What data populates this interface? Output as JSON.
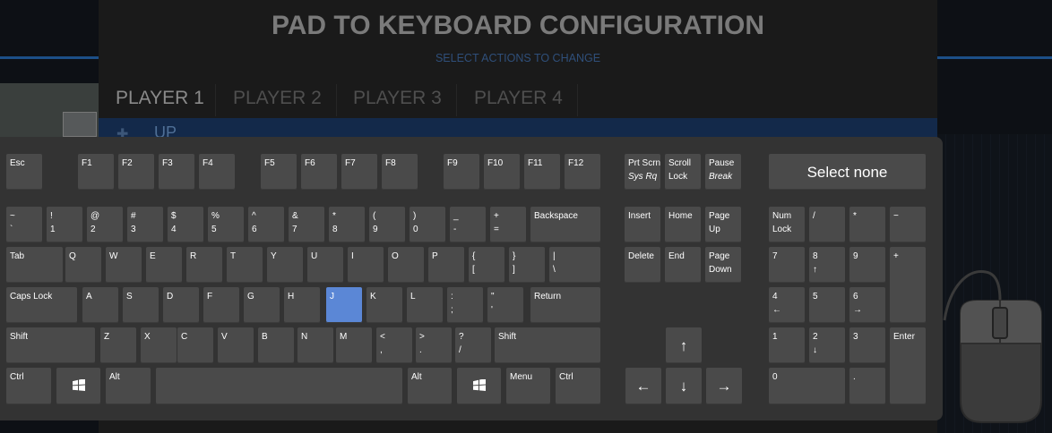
{
  "window": {
    "title": "PAD TO KEYBOARD CONFIGURATION",
    "subtitle": "SELECT ACTIONS TO CHANGE"
  },
  "tabs": [
    {
      "label": "PLAYER 1",
      "active": true
    },
    {
      "label": "PLAYER 2",
      "active": false
    },
    {
      "label": "PLAYER 3",
      "active": false
    },
    {
      "label": "PLAYER 4",
      "active": false
    }
  ],
  "action_row": {
    "label": "UP",
    "icon": "dpad-icon"
  },
  "keyboard": {
    "select_none": "Select none",
    "selected_key": "J",
    "keys": {
      "esc": "Esc",
      "f1": "F1",
      "f2": "F2",
      "f3": "F3",
      "f4": "F4",
      "f5": "F5",
      "f6": "F6",
      "f7": "F7",
      "f8": "F8",
      "f9": "F9",
      "f10": "F10",
      "f11": "F11",
      "f12": "F12",
      "prtscn": "Prt Scrn",
      "sysrq": "Sys Rq",
      "scrolllock1": "Scroll",
      "scrolllock2": "Lock",
      "pause": "Pause",
      "break": "Break",
      "tilde1": "~",
      "tilde2": "`",
      "n1a": "!",
      "n1b": "1",
      "n2a": "@",
      "n2b": "2",
      "n3a": "#",
      "n3b": "3",
      "n4a": "$",
      "n4b": "4",
      "n5a": "%",
      "n5b": "5",
      "n6a": "^",
      "n6b": "6",
      "n7a": "&",
      "n7b": "7",
      "n8a": "*",
      "n8b": "8",
      "n9a": "(",
      "n9b": "9",
      "n0a": ")",
      "n0b": "0",
      "minusa": "_",
      "minusb": "-",
      "eqa": "+",
      "eqb": "=",
      "backspace": "Backspace",
      "insert": "Insert",
      "home": "Home",
      "pageup1": "Page",
      "pageup2": "Up",
      "numlock1": "Num",
      "numlock2": "Lock",
      "npdiv": "/",
      "npmul": "*",
      "npminus": "−",
      "tab": "Tab",
      "q": "Q",
      "w": "W",
      "e": "E",
      "r": "R",
      "t": "T",
      "y": "Y",
      "u": "U",
      "i": "I",
      "o": "O",
      "p": "P",
      "lbra": "{",
      "lbrb": "[",
      "rbra": "}",
      "rbrb": "]",
      "bsla": "|",
      "bslb": "\\",
      "delete": "Delete",
      "end": "End",
      "pagedown1": "Page",
      "pagedown2": "Down",
      "np7": "7",
      "np8a": "8",
      "np8b": "↑",
      "np9": "9",
      "npplus": "+",
      "capslock": "Caps Lock",
      "a": "A",
      "s": "S",
      "d": "D",
      "f": "F",
      "g": "G",
      "h": "H",
      "j": "J",
      "k": "K",
      "l": "L",
      "semia": ":",
      "semib": ";",
      "quota": "\"",
      "quotb": "'",
      "return": "Return",
      "np4a": "4",
      "np4b": "←",
      "np5": "5",
      "np6a": "6",
      "np6b": "→",
      "shift": "Shift",
      "z": "Z",
      "x": "X",
      "c": "C",
      "v": "V",
      "b": "B",
      "n": "N",
      "m": "M",
      "comma1": "<",
      "comma2": ",",
      "dot1": ">",
      "dot2": ".",
      "slash1": "?",
      "slash2": "/",
      "shiftr": "Shift",
      "up": "↑",
      "np1": "1",
      "np2a": "2",
      "np2b": "↓",
      "np3": "3",
      "npenter": "Enter",
      "ctrl": "Ctrl",
      "alt": "Alt",
      "altr": "Alt",
      "menu": "Menu",
      "ctrlr": "Ctrl",
      "left": "←",
      "down": "↓",
      "right": "→",
      "np0": "0",
      "npdot": "."
    }
  },
  "colors": {
    "panel_bg": "#1a1a1a",
    "keyboard_bg": "#333333",
    "key_bg": "#4a4a4a",
    "selected_key": "#5b87d6",
    "accent_blue": "#1c4f88"
  }
}
